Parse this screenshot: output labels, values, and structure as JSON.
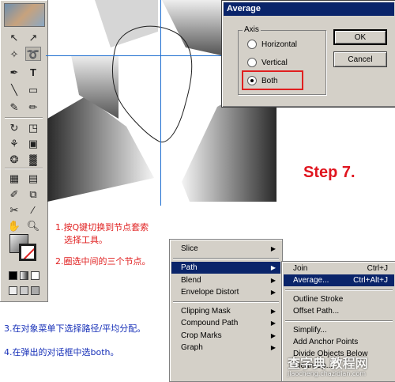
{
  "dialog": {
    "title": "Average",
    "axis_label": "Axis",
    "options": [
      "Horizontal",
      "Vertical",
      "Both"
    ],
    "selected": "Both",
    "ok_label": "OK",
    "cancel_label": "Cancel"
  },
  "step_heading": "Step 7.",
  "instructions": [
    {
      "text": "1.按Q键切换到节点套索",
      "color": "red"
    },
    {
      "text": "选择工具。",
      "color": "red"
    },
    {
      "text": "2.圈选中间的三个节点。",
      "color": "red"
    },
    {
      "text": "3.在对象菜单下选择路径/平均分配。",
      "color": "blue"
    },
    {
      "text": "4.在弹出的对话框中选both。",
      "color": "blue"
    }
  ],
  "object_menu": {
    "items": [
      {
        "label": "Slice",
        "submenu": true
      },
      {
        "label": "Path",
        "submenu": true,
        "selected": true
      },
      {
        "label": "Blend",
        "submenu": true
      },
      {
        "label": "Envelope Distort",
        "submenu": true
      },
      {
        "label": "Clipping Mask",
        "submenu": true
      },
      {
        "label": "Compound Path",
        "submenu": true
      },
      {
        "label": "Crop Marks",
        "submenu": true
      },
      {
        "label": "Graph",
        "submenu": true
      }
    ]
  },
  "path_submenu": {
    "items": [
      {
        "label": "Join",
        "shortcut": "Ctrl+J"
      },
      {
        "label": "Average...",
        "shortcut": "Ctrl+Alt+J",
        "selected": true
      },
      {
        "label": "Outline Stroke",
        "shortcut": ""
      },
      {
        "label": "Offset Path...",
        "shortcut": ""
      },
      {
        "label": "Simplify...",
        "shortcut": ""
      },
      {
        "label": "Add Anchor Points",
        "shortcut": ""
      },
      {
        "label": "Divide Objects Below",
        "shortcut": ""
      },
      {
        "label": "Clean Up...",
        "shortcut": ""
      }
    ]
  },
  "watermark": {
    "text": "查字典 教程网",
    "url": "jiaocheng.chazidian.com"
  },
  "colors": {
    "accent_red": "#e0151f",
    "instruction_blue": "#1730b8",
    "menu_highlight": "#0a246a",
    "guide_blue": "#1f6fd0"
  }
}
